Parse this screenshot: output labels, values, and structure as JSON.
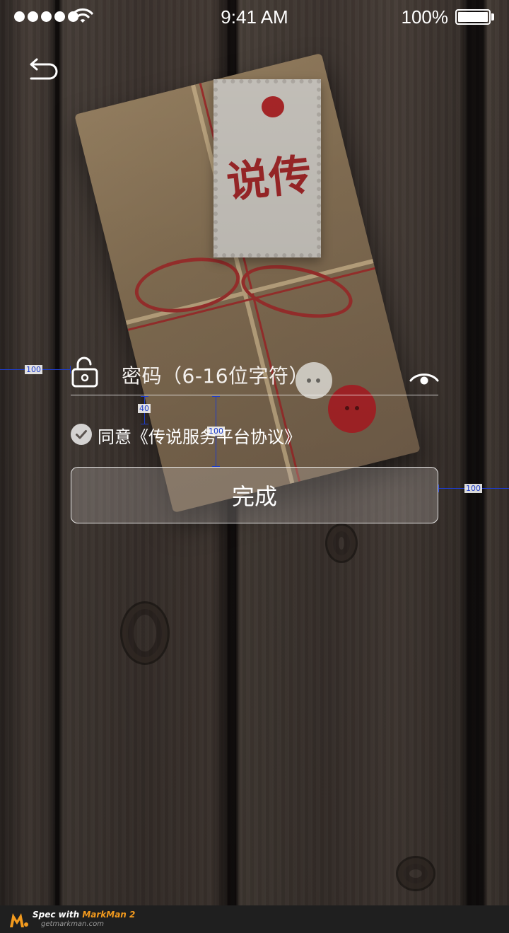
{
  "status_bar": {
    "time": "9:41 AM",
    "battery_percent": "100%"
  },
  "background": {
    "tag_text": "说传"
  },
  "form": {
    "password_placeholder": "密码（6-16位字符）",
    "agreement_prefix": "同意",
    "agreement_link": "《传说服务平台协议》",
    "agreement_checked": true,
    "submit_label": "完成"
  },
  "spec": {
    "left_margin": "100",
    "right_margin": "100",
    "input_to_checkbox": "40",
    "input_to_button": "100"
  },
  "footer": {
    "title_prefix": "Spec with ",
    "title_brand": "MarkMan 2",
    "url": "getmarkman.com"
  },
  "icons": [
    "back-arrow-icon",
    "lock-open-icon",
    "eye-icon",
    "check-icon",
    "wifi-icon",
    "battery-icon",
    "markman-logo"
  ],
  "colors": {
    "spec_blue": "#1e3cc9",
    "markman_orange": "#f29a1e",
    "footer_bg": "#1f1f1f"
  }
}
